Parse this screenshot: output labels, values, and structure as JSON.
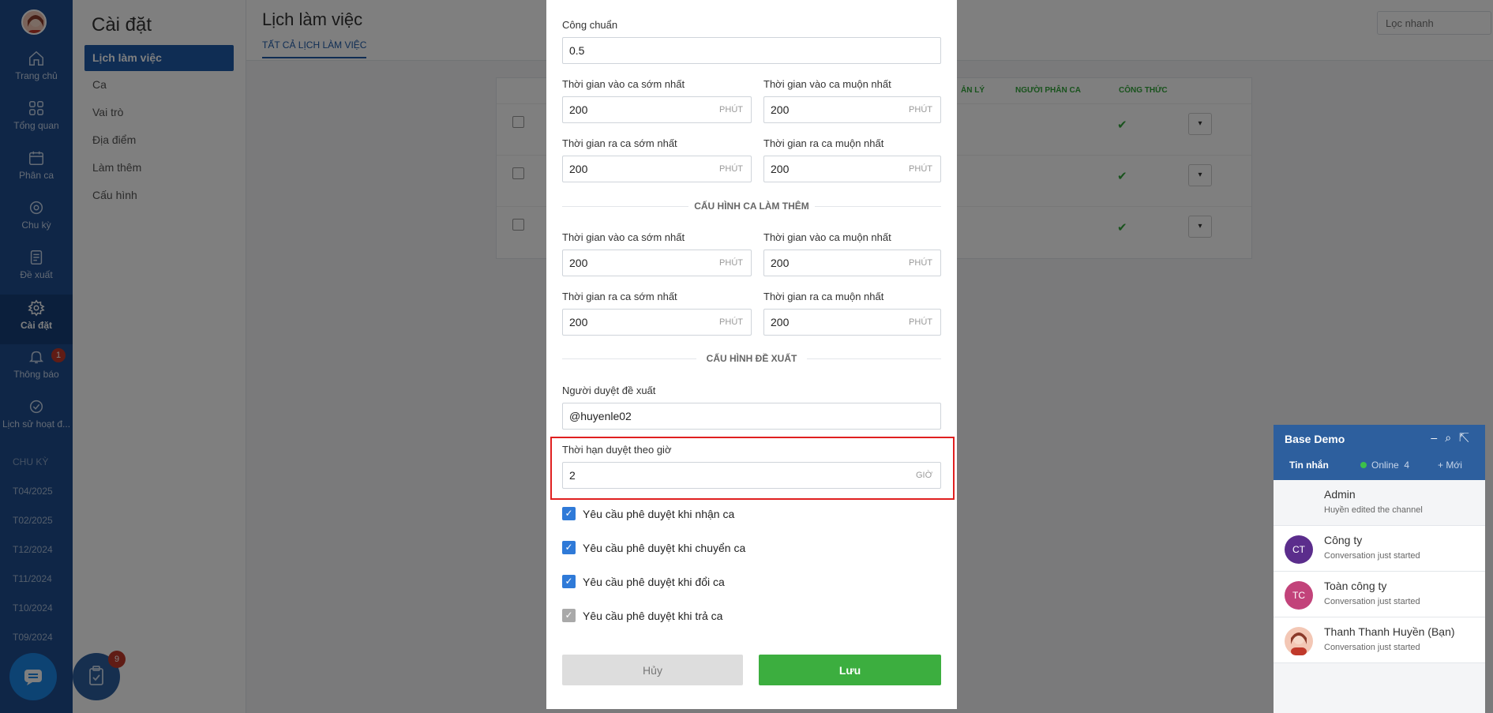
{
  "nav": {
    "items": [
      {
        "label": "Trang chủ",
        "icon": "home-icon"
      },
      {
        "label": "Tổng quan",
        "icon": "grid-icon"
      },
      {
        "label": "Phân ca",
        "icon": "calendar-icon"
      },
      {
        "label": "Chu kỳ",
        "icon": "cycle-icon"
      },
      {
        "label": "Đề xuất",
        "icon": "document-icon"
      },
      {
        "label": "Cài đặt",
        "icon": "gear-icon"
      },
      {
        "label": "Thông báo",
        "icon": "bell-icon"
      },
      {
        "label": "Lịch sử hoạt đ...",
        "icon": "check-circle-icon"
      }
    ],
    "notification_count": "1",
    "section_label": "CHU KỲ",
    "periods": [
      "T04/2025",
      "T02/2025",
      "T12/2024",
      "T11/2024",
      "T10/2024",
      "T09/2024"
    ],
    "task_badge": "9"
  },
  "settings": {
    "title": "Cài đặt",
    "items": [
      "Lịch làm việc",
      "Ca",
      "Vai trò",
      "Địa điểm",
      "Làm thêm",
      "Cấu hình"
    ]
  },
  "page": {
    "title": "Lịch làm việc",
    "tab": "TẤT CẢ LỊCH LÀM VIỆC",
    "quick_filter_placeholder": "Lọc nhanh",
    "table_headers": {
      "manager": "ẢN LÝ",
      "assigner": "NGƯỜI PHÂN CA",
      "formula": "CÔNG THỨC"
    }
  },
  "modal": {
    "standard_work_label": "Công chuẩn",
    "standard_work_value": "0.5",
    "earliest_checkin_label": "Thời gian vào ca sớm nhất",
    "latest_checkin_label": "Thời gian vào ca muộn nhất",
    "earliest_checkout_label": "Thời gian ra ca sớm nhất",
    "latest_checkout_label": "Thời gian ra ca muộn nhất",
    "minute_unit": "PHÚT",
    "shift_values": {
      "in_early": "200",
      "in_late": "200",
      "out_early": "200",
      "out_late": "200"
    },
    "overtime_section": "CẤU HÌNH CA LÀM THÊM",
    "overtime_values": {
      "in_early": "200",
      "in_late": "200",
      "out_early": "200",
      "out_late": "200"
    },
    "proposal_section": "CẤU HÌNH ĐỀ XUẤT",
    "approver_label": "Người duyệt đề xuất",
    "approver_value": "@huyenle02",
    "deadline_label": "Thời hạn duyệt theo giờ",
    "deadline_value": "2",
    "hour_unit": "GIỜ",
    "checkboxes": [
      "Yêu cầu phê duyệt khi nhận ca",
      "Yêu cầu phê duyệt khi chuyển ca",
      "Yêu cầu phê duyệt khi đổi ca",
      "Yêu cầu phê duyệt khi trả ca"
    ],
    "cancel_label": "Hủy",
    "save_label": "Lưu"
  },
  "chat": {
    "title": "Base Demo",
    "tab_messages": "Tin nhắn",
    "tab_online": "Online",
    "online_count": "4",
    "tab_new": "+ Mới",
    "conversations": [
      {
        "name": "Admin",
        "sub": "Huyền edited the channel",
        "initials": ""
      },
      {
        "name": "Công ty",
        "sub": "Conversation just started",
        "initials": "CT"
      },
      {
        "name": "Toàn công ty",
        "sub": "Conversation just started",
        "initials": "TC"
      },
      {
        "name": "Thanh Thanh Huyền (Bạn)",
        "sub": "Conversation just started",
        "initials": ""
      }
    ]
  }
}
